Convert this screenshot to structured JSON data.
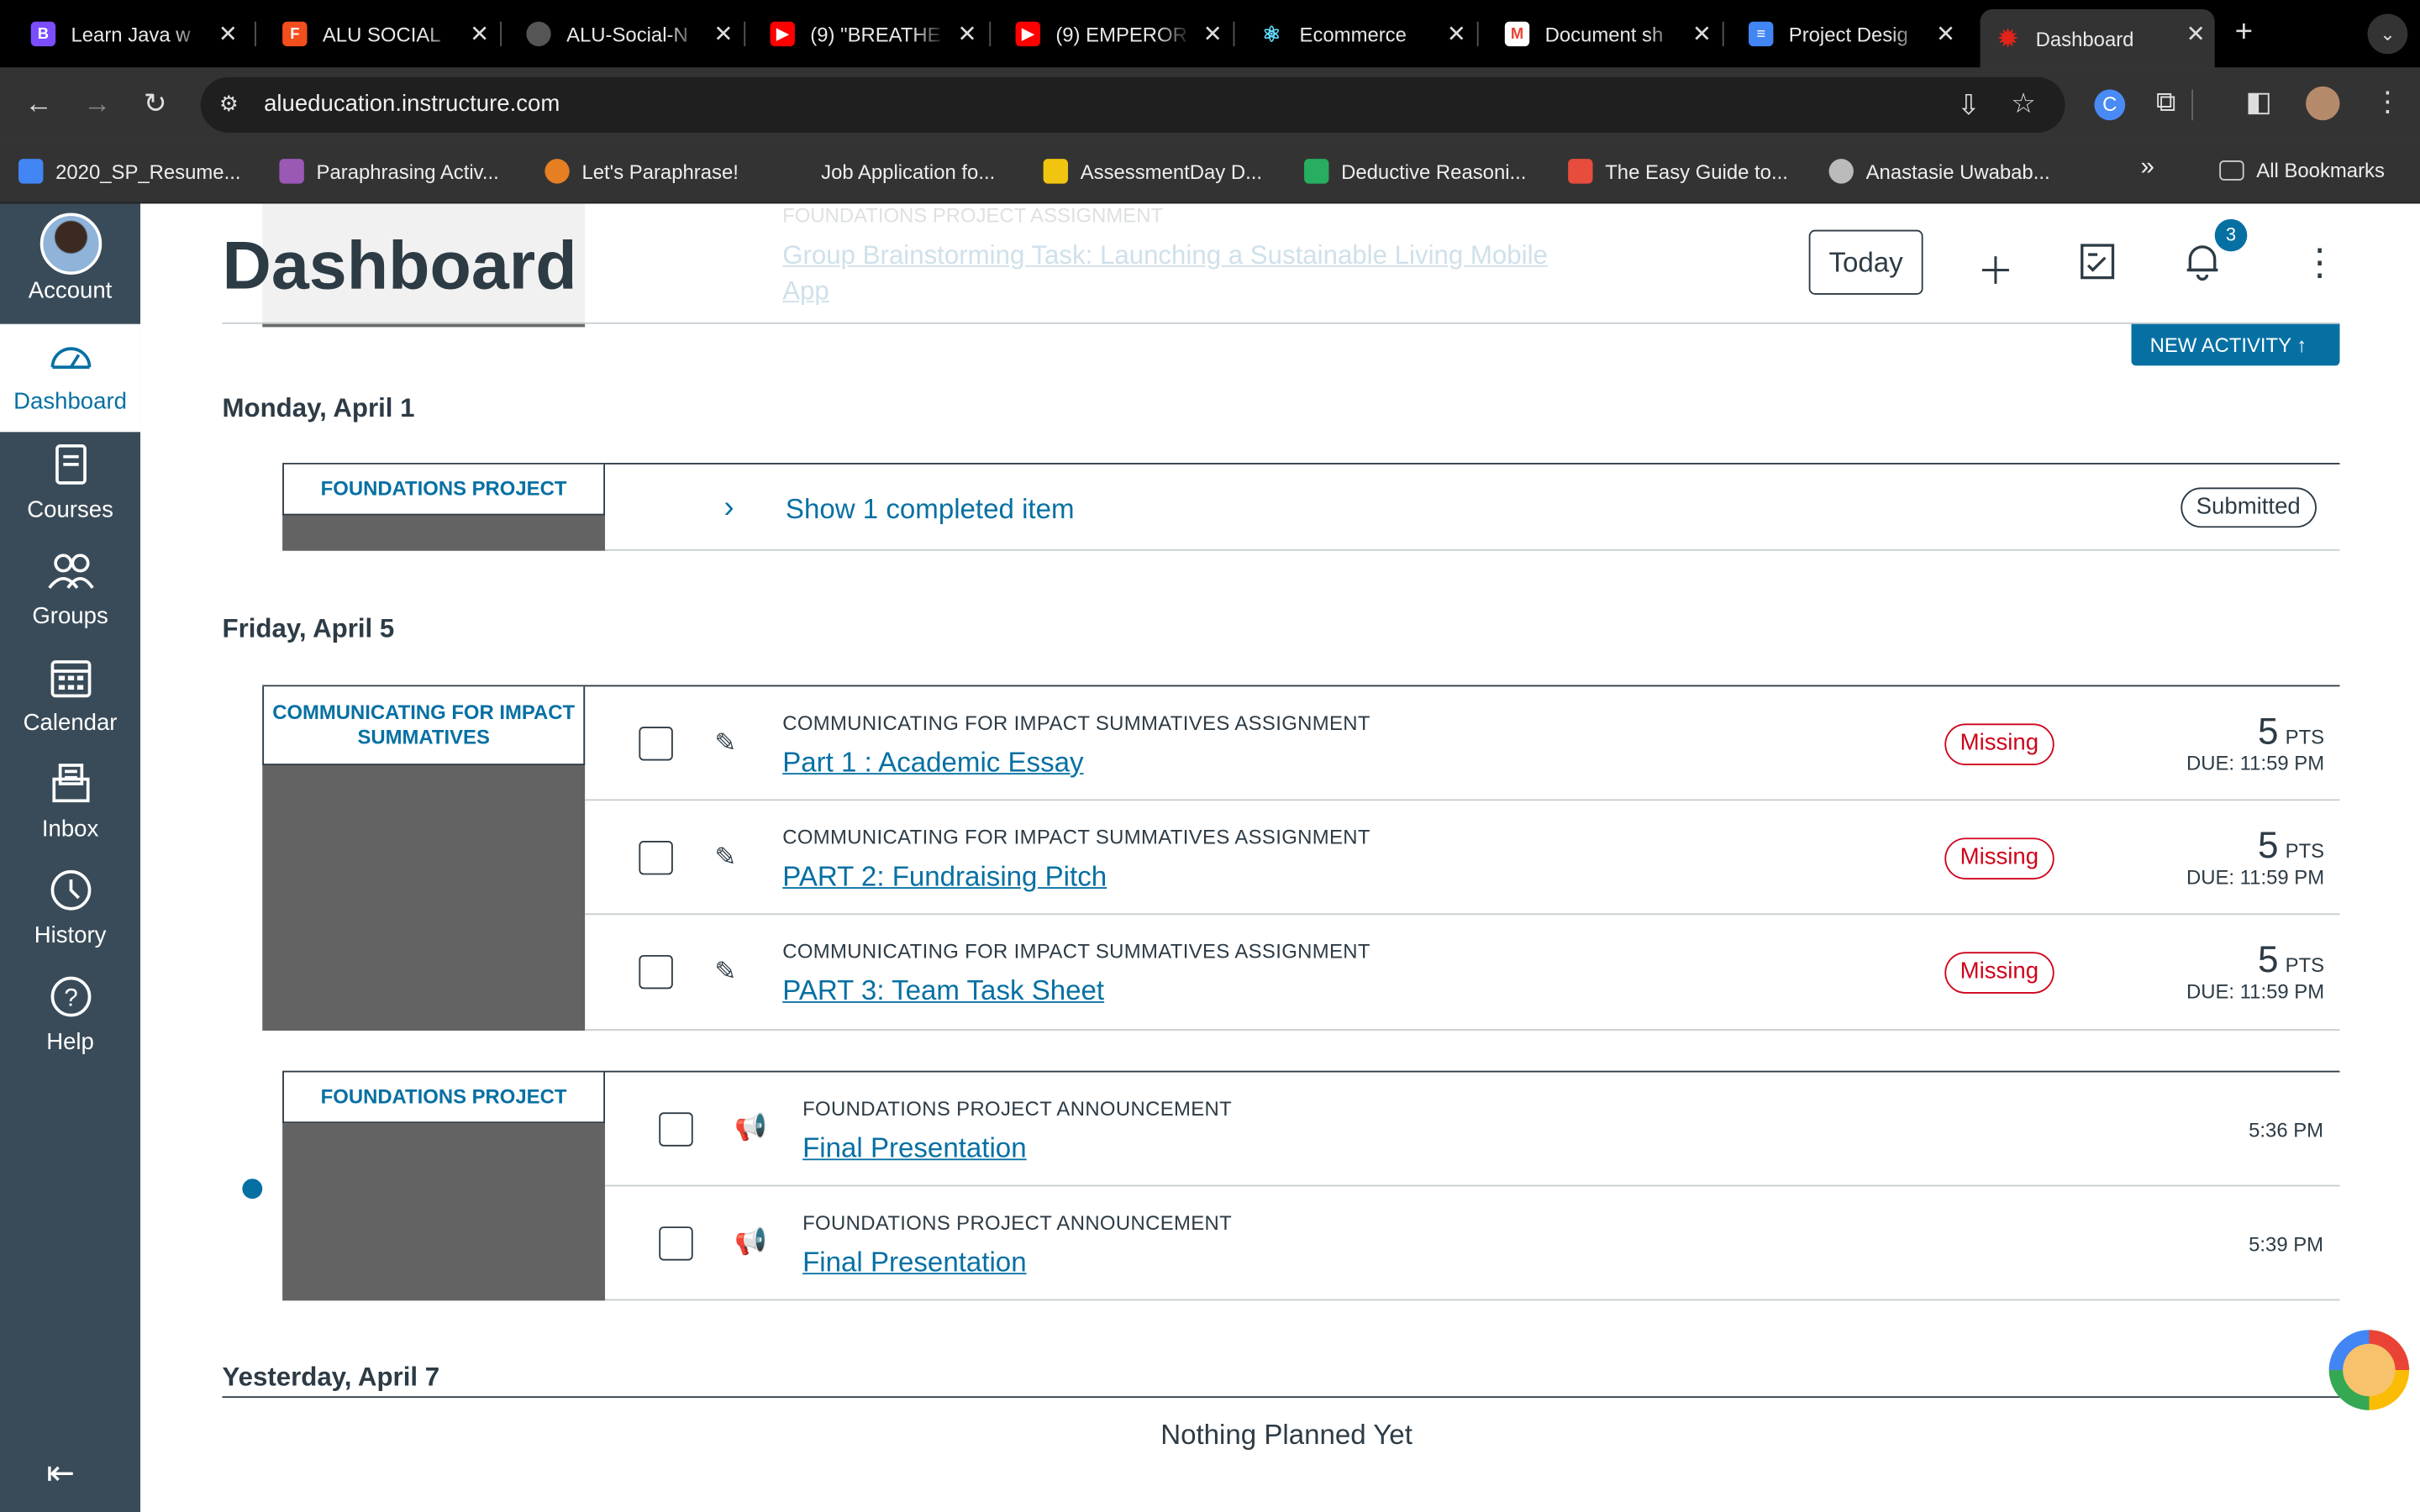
{
  "browser": {
    "tabs": [
      {
        "title": "Learn Java w",
        "favicon": "B",
        "color": "#7b4dff"
      },
      {
        "title": "ALU SOCIAL",
        "favicon": "F",
        "color": "#f24e1e"
      },
      {
        "title": "ALU-Social-N",
        "favicon": "",
        "color": "#555555"
      },
      {
        "title": "(9) \"BREATHE",
        "favicon": "▶",
        "color": "#ff0000"
      },
      {
        "title": "(9) EMPEROR",
        "favicon": "▶",
        "color": "#ff0000"
      },
      {
        "title": "Ecommerce",
        "favicon": "⚛",
        "color": "#000000"
      },
      {
        "title": "Document sh",
        "favicon": "M",
        "color": "#ffffff"
      },
      {
        "title": "Project Desig",
        "favicon": "≡",
        "color": "#4285f4"
      },
      {
        "title": "Dashboard",
        "favicon": "✹",
        "color": "#e2231a"
      }
    ],
    "url": "alueducation.instructure.com",
    "bookmarks": [
      {
        "label": "2020_SP_Resume...",
        "color": "#4285f4"
      },
      {
        "label": "Paraphrasing Activ...",
        "color": "#9b59b6"
      },
      {
        "label": "Let's Paraphrase!",
        "color": "#e67e22"
      },
      {
        "label": "Job Application fo...",
        "color": "#333333"
      },
      {
        "label": "AssessmentDay D...",
        "color": "#f1c40f"
      },
      {
        "label": "Deductive Reasoni...",
        "color": "#27ae60"
      },
      {
        "label": "The Easy Guide to...",
        "color": "#e74c3c"
      },
      {
        "label": "Anastasie Uwabab...",
        "color": "#bbbbbb"
      }
    ],
    "all_bookmarks": "All Bookmarks"
  },
  "nav": {
    "account": "Account",
    "dashboard": "Dashboard",
    "courses": "Courses",
    "groups": "Groups",
    "calendar": "Calendar",
    "inbox": "Inbox",
    "history": "History",
    "help": "Help"
  },
  "header": {
    "title": "Dashboard",
    "today": "Today",
    "notification_count": "3",
    "new_activity": "NEW ACTIVITY",
    "ghost_type": "FOUNDATIONS PROJECT ASSIGNMENT",
    "ghost_title": "Group Brainstorming Task: Launching a Sustainable Living Mobile App"
  },
  "days": {
    "monday": "Monday, April 1",
    "friday": "Friday, April 5",
    "yesterday": "Yesterday, April 7"
  },
  "monday_group": {
    "course": "FOUNDATIONS PROJECT",
    "show_completed": "Show 1 completed item",
    "status": "Submitted"
  },
  "friday_group1": {
    "course": "COMMUNICATING FOR IMPACT SUMMATIVES",
    "items": [
      {
        "type": "COMMUNICATING FOR IMPACT SUMMATIVES ASSIGNMENT",
        "title": "Part 1 : Academic Essay",
        "status": "Missing",
        "points": "5",
        "pts_label": "PTS",
        "due": "DUE: 11:59 PM"
      },
      {
        "type": "COMMUNICATING FOR IMPACT SUMMATIVES ASSIGNMENT",
        "title": "PART 2: Fundraising Pitch",
        "status": "Missing",
        "points": "5",
        "pts_label": "PTS",
        "due": "DUE: 11:59 PM"
      },
      {
        "type": "COMMUNICATING FOR IMPACT SUMMATIVES ASSIGNMENT",
        "title": "PART 3: Team Task Sheet",
        "status": "Missing",
        "points": "5",
        "pts_label": "PTS",
        "due": "DUE: 11:59 PM"
      }
    ]
  },
  "friday_group2": {
    "course": "FOUNDATIONS PROJECT",
    "items": [
      {
        "type": "FOUNDATIONS PROJECT ANNOUNCEMENT",
        "title": "Final Presentation",
        "time": "5:36 PM"
      },
      {
        "type": "FOUNDATIONS PROJECT ANNOUNCEMENT",
        "title": "Final Presentation",
        "time": "5:39 PM"
      }
    ]
  },
  "yesterday": {
    "empty": "Nothing Planned Yet"
  },
  "colors": {
    "canvas_blue": "#0770a3",
    "nav_bg": "#394b58",
    "missing_red": "#d0021b",
    "course_card": "#636363"
  }
}
